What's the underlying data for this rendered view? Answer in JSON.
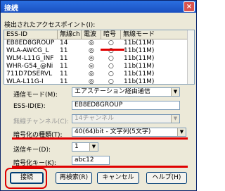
{
  "window": {
    "title": "接続",
    "close_glyph": "×"
  },
  "list_label": "検出されたアクセスポイント(I):",
  "table": {
    "columns": [
      "ESS-ID",
      "無線ch",
      "電波",
      "暗号",
      "無線モード"
    ],
    "rows": [
      [
        "EB8ED8GROUP",
        "14",
        "◎",
        "○",
        "11b(11M)"
      ],
      [
        "WLA-AWCG_L",
        "11",
        "◎",
        "○",
        "11b(11M)"
      ],
      [
        "WLM-L11G_INF",
        "11",
        "◎",
        "○",
        "11b(11M)"
      ],
      [
        "WHR-G54_@Ni",
        "11",
        "◎",
        "○",
        "11b(11M)"
      ],
      [
        "711D7DSERVL",
        "11",
        "◎",
        "○",
        "11b(11M)"
      ],
      [
        "WLA-L11G-I",
        "11",
        "◎",
        "○",
        "11b(11M)"
      ]
    ]
  },
  "form": {
    "comm_mode_label": "通信モード(M):",
    "comm_mode_value": "エアステーション経由通信",
    "essid_label": "ESS-ID(E):",
    "essid_value": "EB8ED8GROUP",
    "channel_label": "無線チャンネル(C):",
    "channel_value": "14チャンネル",
    "enc_type_label": "暗号化の種類(T):",
    "enc_type_value": "40(64)bit - 文字列(5文字)",
    "tx_key_label": "送信キー(D):",
    "tx_key_value": "1",
    "enc_key_label": "暗号化キー(K):",
    "enc_key_value": "abc12"
  },
  "buttons": {
    "connect": "接続",
    "rescan": "再検索(R)",
    "cancel": "キャンセル",
    "help": "ヘルプ(H)"
  },
  "colors": {
    "highlight": "#e00000"
  }
}
